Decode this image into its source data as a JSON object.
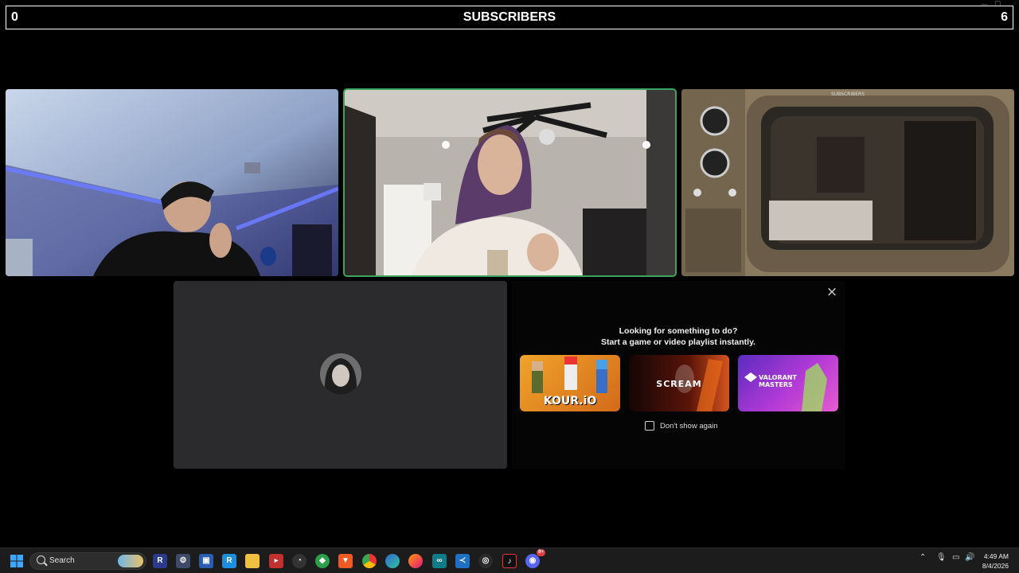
{
  "subscribers_bar": {
    "left_count": "0",
    "title": "SUBSCRIBERS",
    "right_count": "6"
  },
  "video_tiles": [
    {
      "name": "participant-1",
      "speaking": false
    },
    {
      "name": "participant-2",
      "speaking": true
    },
    {
      "name": "participant-3",
      "speaking": false,
      "tv_label": "SUBSCRIBERS"
    }
  ],
  "activity_panel": {
    "heading_line1": "Looking for something to do?",
    "heading_line2": "Start a game or video playlist instantly.",
    "cards": [
      {
        "title": "KOUR.iO",
        "color": "#e8951c"
      },
      {
        "title": "SCREAM",
        "color": "#b8321a"
      },
      {
        "title": "VALORANT MASTERS",
        "color": "#8a3fd1"
      }
    ],
    "dont_show_label": "Don't show again",
    "close_icon": "×"
  },
  "taskbar": {
    "search_placeholder": "Search",
    "clock_time": "4:49 AM",
    "clock_date": "8/4/2026",
    "discord_badge": "9+"
  },
  "colors": {
    "speaking_outline": "#3ba55d",
    "empty_tile": "#2b2b2d"
  }
}
